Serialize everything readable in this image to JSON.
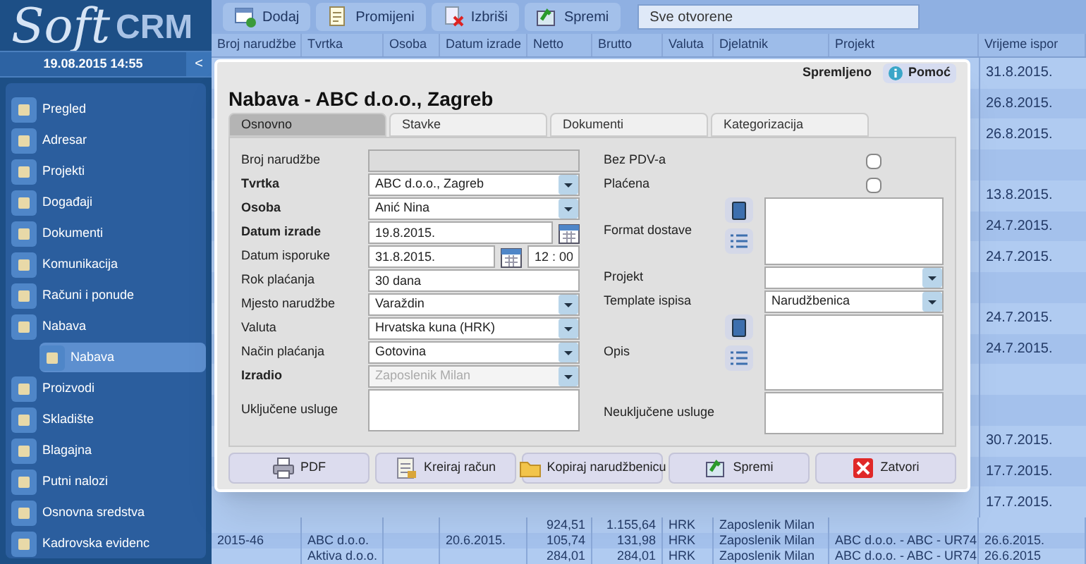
{
  "logo": {
    "script_part": "Soft",
    "bold_part": "CRM"
  },
  "sidebar": {
    "datetime": "19.08.2015 14:55",
    "collapse_button": "<",
    "items": [
      {
        "label": "Pregled",
        "selected": false
      },
      {
        "label": "Adresar",
        "selected": false
      },
      {
        "label": "Projekti",
        "selected": false
      },
      {
        "label": "Događaji",
        "selected": false
      },
      {
        "label": "Dokumenti",
        "selected": false
      },
      {
        "label": "Komunikacija",
        "selected": false
      },
      {
        "label": "Računi i ponude",
        "selected": false
      },
      {
        "label": "Nabava",
        "selected": false,
        "children": [
          {
            "label": "Nabava",
            "selected": true
          }
        ]
      },
      {
        "label": "Proizvodi",
        "selected": false
      },
      {
        "label": "Skladište",
        "selected": false
      },
      {
        "label": "Blagajna",
        "selected": false
      },
      {
        "label": "Putni nalozi",
        "selected": false
      },
      {
        "label": "Osnovna sredstva",
        "selected": false
      },
      {
        "label": "Kadrovska evidenc",
        "selected": false
      }
    ]
  },
  "toolbar": {
    "buttons": [
      {
        "label": "Dodaj"
      },
      {
        "label": "Promijeni"
      },
      {
        "label": "Izbriši"
      },
      {
        "label": "Spremi"
      }
    ],
    "filter": "Sve otvorene"
  },
  "table": {
    "columns": [
      "Broj narudžbe",
      "Tvrtka",
      "Osoba",
      "Datum izrade",
      "Netto",
      "Brutto",
      "Valuta",
      "Djelatnik",
      "Projekt",
      "Vrijeme ispor"
    ],
    "visible_delivery_dates": [
      {
        "kind": "date",
        "value": "31.8.2015."
      },
      {
        "kind": "date",
        "value": "26.8.2015."
      },
      {
        "kind": "date",
        "value": "26.8.2015."
      },
      {
        "kind": "blank"
      },
      {
        "kind": "date",
        "value": "13.8.2015."
      },
      {
        "kind": "date",
        "value": "24.7.2015."
      },
      {
        "kind": "date",
        "value": "24.7.2015."
      },
      {
        "kind": "blank"
      },
      {
        "kind": "date",
        "value": "24.7.2015."
      },
      {
        "kind": "date",
        "value": "24.7.2015."
      },
      {
        "kind": "blank"
      },
      {
        "kind": "blank"
      },
      {
        "kind": "date",
        "value": "30.7.2015."
      },
      {
        "kind": "date",
        "value": "17.7.2015."
      },
      {
        "kind": "date",
        "value": "17.7.2015."
      }
    ],
    "bottom_rows": [
      [
        "",
        "",
        "",
        "",
        "924,51",
        "1.155,64",
        "HRK",
        "Zaposlenik Milan",
        "",
        ""
      ],
      [
        "2015-46",
        "ABC d.o.o.",
        "",
        "20.6.2015.",
        "105,74",
        "131,98",
        "HRK",
        "Zaposlenik Milan",
        "ABC d.o.o. - ABC - UR74",
        "26.6.2015."
      ],
      [
        "",
        "Aktiva d.o.o.",
        "",
        "",
        "284,01",
        "284,01",
        "HRK",
        "Zaposlenik Milan",
        "ABC d.o.o. - ABC - UR74",
        "26.6.2015"
      ]
    ]
  },
  "dialog": {
    "status": "Spremljeno",
    "help_button": "Pomoć",
    "title": "Nabava - ABC d.o.o., Zagreb",
    "tabs": [
      {
        "label": "Osnovno",
        "selected": true
      },
      {
        "label": "Stavke",
        "selected": false
      },
      {
        "label": "Dokumenti",
        "selected": false
      },
      {
        "label": "Kategorizacija",
        "selected": false
      }
    ],
    "left_fields": [
      {
        "kind": "text",
        "label": "Broj narudžbe",
        "bold": false,
        "disabled": true
      },
      {
        "kind": "select",
        "label": "Tvrtka",
        "bold": true,
        "disabled": false,
        "value": "ABC d.o.o., Zagreb"
      },
      {
        "kind": "select",
        "label": "Osoba",
        "bold": true,
        "disabled": false,
        "value": "Anić Nina"
      },
      {
        "kind": "date",
        "label": "Datum izrade",
        "bold": true,
        "disabled": false,
        "value": "19.8.2015."
      },
      {
        "kind": "datetime",
        "label": "Datum isporuke",
        "bold": false,
        "disabled": false,
        "value": "31.8.2015.",
        "time": "12 : 00"
      },
      {
        "kind": "text",
        "label": "Rok plaćanja",
        "bold": false,
        "disabled": false,
        "value": "30 dana"
      },
      {
        "kind": "select",
        "label": "Mjesto narudžbe",
        "bold": false,
        "disabled": false,
        "value": "Varaždin"
      },
      {
        "kind": "select",
        "label": "Valuta",
        "bold": false,
        "disabled": false,
        "value": "Hrvatska kuna (HRK)"
      },
      {
        "kind": "select",
        "label": "Način plaćanja",
        "bold": false,
        "disabled": false,
        "value": "Gotovina"
      },
      {
        "kind": "select",
        "label": "Izradio",
        "bold": true,
        "disabled": true,
        "value": "Zaposlenik Milan"
      },
      {
        "kind": "textarea",
        "label": "Uključene usluge",
        "bold": false,
        "disabled": false
      }
    ],
    "right_fields": [
      {
        "kind": "checkbox",
        "label": "Bez PDV-a",
        "checked": false
      },
      {
        "kind": "checkbox",
        "label": "Plaćena",
        "checked": false
      },
      {
        "kind": "textarea_tools",
        "label": "Format dostave"
      },
      {
        "kind": "select",
        "label": "Projekt"
      },
      {
        "kind": "select",
        "label": "Template ispisa",
        "value": "Narudžbenica"
      },
      {
        "kind": "textarea_tools",
        "label": "Opis"
      },
      {
        "kind": "textarea",
        "label": "Neuključene usluge"
      }
    ],
    "buttons": [
      {
        "label": "PDF"
      },
      {
        "label": "Kreiraj račun"
      },
      {
        "label": "Kopiraj narudžbenicu"
      },
      {
        "label": "Spremi"
      },
      {
        "label": "Zatvori"
      }
    ]
  }
}
